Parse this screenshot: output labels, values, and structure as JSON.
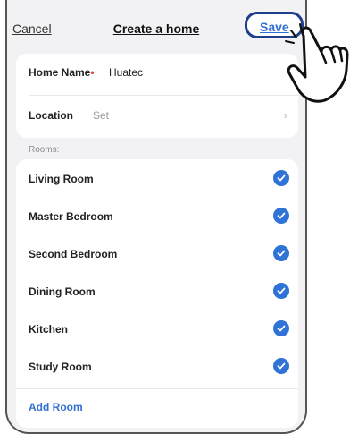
{
  "header": {
    "cancel_label": "Cancel",
    "title": "Create a home",
    "save_label": "Save"
  },
  "form": {
    "home_name": {
      "label": "Home Name",
      "required_mark": "•",
      "value": "Huatec"
    },
    "location": {
      "label": "Location",
      "placeholder": "Set",
      "chevron": "›"
    }
  },
  "rooms": {
    "section_label": "Rooms:",
    "items": [
      {
        "label": "Living Room",
        "checked": true
      },
      {
        "label": "Master Bedroom",
        "checked": true
      },
      {
        "label": "Second Bedroom",
        "checked": true
      },
      {
        "label": "Dining Room",
        "checked": true
      },
      {
        "label": "Kitchen",
        "checked": true
      },
      {
        "label": "Study Room",
        "checked": true
      }
    ],
    "add_label": "Add Room"
  },
  "icons": {
    "check": "check-circle-icon",
    "pointer": "pointing-hand-icon"
  },
  "colors": {
    "accent": "#2f73d6",
    "highlight_border": "#1f3f8c",
    "required": "#e0452d"
  }
}
